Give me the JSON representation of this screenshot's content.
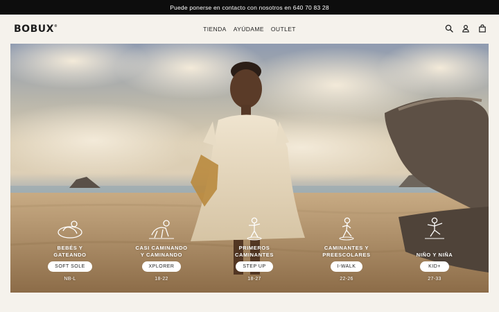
{
  "announcement": "Puede ponerse en contacto con nosotros en 640 70 83 28",
  "brand": "BOBUX",
  "nav": [
    "TIENDA",
    "AYÚDAME",
    "OUTLET"
  ],
  "header_icons": [
    "search-icon",
    "account-icon",
    "cart-icon"
  ],
  "categories": [
    {
      "name": "BEBÉS Y\nGATEANDO",
      "button": "SOFT SOLE",
      "size": "NB-L",
      "icon": "crawling-baby-icon"
    },
    {
      "name": "CASI CAMINANDO\nY CAMINANDO",
      "button": "XPLORER",
      "size": "18-22",
      "icon": "crawling-toddler-icon"
    },
    {
      "name": "PRIMEROS\nCAMINANTES",
      "button": "STEP UP",
      "size": "18-27",
      "icon": "first-walker-icon"
    },
    {
      "name": "CAMINANTES Y\nPREESCOLARES",
      "button": "I-WALK",
      "size": "22-26",
      "icon": "walking-child-icon"
    },
    {
      "name": "NIÑO Y NIÑA",
      "button": "KID+",
      "size": "27-33",
      "icon": "kid-balancing-icon"
    }
  ],
  "colors": {
    "background": "#f5f2ec",
    "announcement_bar": "#0d0d0d",
    "text": "#1e1e1e"
  }
}
